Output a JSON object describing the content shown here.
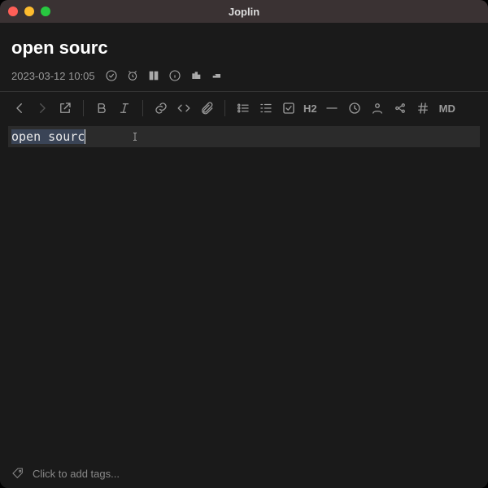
{
  "window": {
    "title": "Joplin"
  },
  "note": {
    "title": "open sourc",
    "timestamp": "2023-03-12 10:05",
    "editor_text": "open sourc"
  },
  "toolbar": {
    "heading_label": "H2",
    "md_label": "MD"
  },
  "footer": {
    "tags_placeholder": "Click to add tags..."
  }
}
